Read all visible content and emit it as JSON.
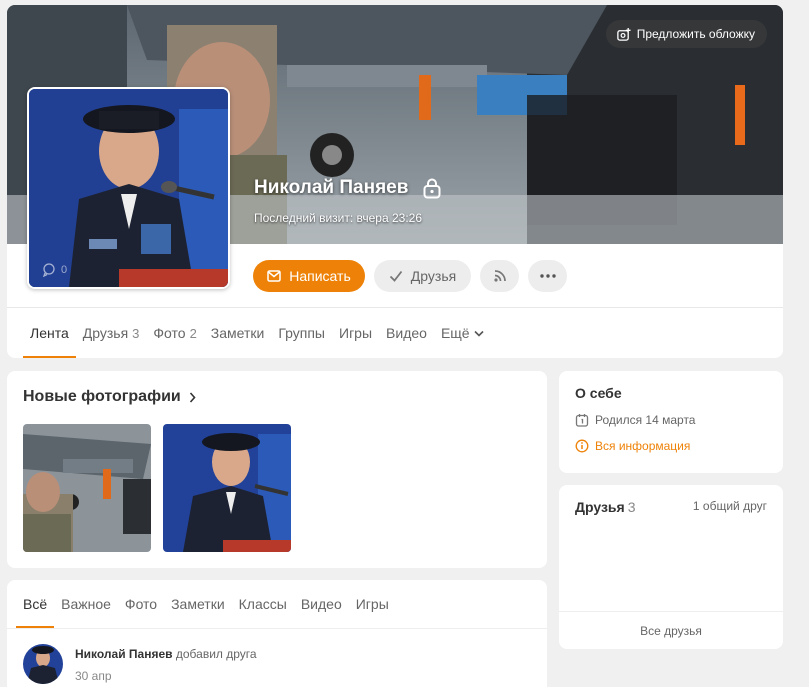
{
  "profile": {
    "name": "Николай Паняев",
    "last_visit": "Последний визит: вчера 23:26",
    "suggest_cover": "Предложить обложку",
    "avatar_counter": "0",
    "buttons": {
      "write": "Написать",
      "friends": "Друзья"
    }
  },
  "nav_tabs": [
    {
      "label": "Лента",
      "count": ""
    },
    {
      "label": "Друзья",
      "count": "3"
    },
    {
      "label": "Фото",
      "count": "2"
    },
    {
      "label": "Заметки",
      "count": ""
    },
    {
      "label": "Группы",
      "count": ""
    },
    {
      "label": "Игры",
      "count": ""
    },
    {
      "label": "Видео",
      "count": ""
    },
    {
      "label": "Ещё",
      "count": ""
    }
  ],
  "new_photos": {
    "title": "Новые фотографии"
  },
  "feed": {
    "tabs": [
      "Всё",
      "Важное",
      "Фото",
      "Заметки",
      "Классы",
      "Видео",
      "Игры"
    ],
    "item": {
      "author": "Николай Паняев",
      "action": "добавил друга",
      "date": "30 апр"
    }
  },
  "about": {
    "title": "О себе",
    "birth": "Родился 14 марта",
    "all_info": "Вся информация"
  },
  "friends": {
    "title": "Друзья",
    "count": "3",
    "mutual": "1 общий друг",
    "all_link": "Все друзья"
  },
  "colors": {
    "accent": "#ee8208",
    "background": "#f0f0f0",
    "card": "#ffffff"
  }
}
